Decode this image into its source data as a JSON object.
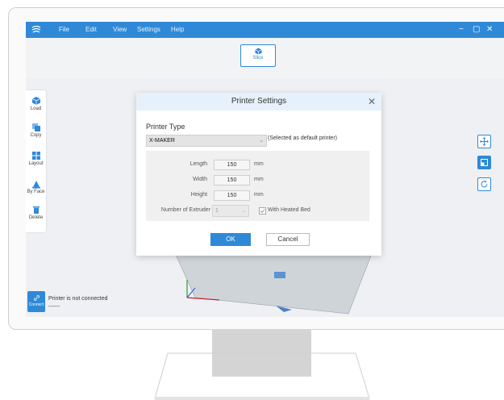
{
  "menu": [
    "File",
    "Edit",
    "View",
    "Settings",
    "Help"
  ],
  "window_controls": {
    "minimize": "−",
    "maximize": "▢",
    "close": "✕"
  },
  "toolbar": {
    "slice_label": "Slice"
  },
  "sidebar": {
    "items": [
      {
        "label": "Load",
        "icon": "cube-icon"
      },
      {
        "label": "Copy",
        "icon": "copy-icon"
      },
      {
        "label": "Layout",
        "icon": "layout-grid-icon"
      },
      {
        "label": "By Face",
        "icon": "by-face-icon"
      },
      {
        "label": "Delete",
        "icon": "trash-icon"
      }
    ]
  },
  "right_tools": [
    "move-icon",
    "scale-icon",
    "rotate-icon"
  ],
  "status": {
    "connect_label": "Connect",
    "text": "Printer is not connected",
    "sub": "------"
  },
  "dialog": {
    "title": "Printer Settings",
    "close": "✕",
    "printer_type_label": "Printer Type",
    "printer_selected": "X-MAKER",
    "default_note": "(Selected as default printer)",
    "length_label": "Length",
    "length_value": "150",
    "width_label": "Width",
    "width_value": "150",
    "height_label": "Height",
    "height_value": "150",
    "unit": "mm",
    "extruder_label": "Number of Extruder",
    "extruder_value": "1",
    "heated_bed_label": "With Heated Bed",
    "heated_bed_checked": true,
    "ok_label": "OK",
    "cancel_label": "Cancel"
  },
  "colors": {
    "accent": "#2f89d7",
    "dialog_header": "#e6f1fb"
  }
}
